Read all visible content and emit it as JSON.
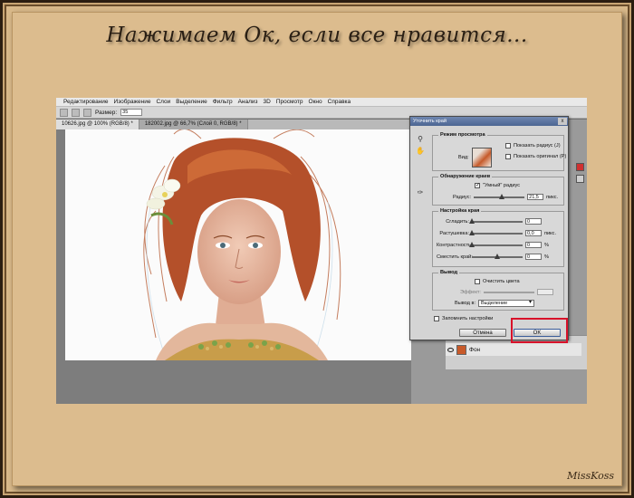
{
  "caption": "Нажимаем Ок, если все нравится...",
  "signature": "MissKoss",
  "menubar": [
    "Редактирование",
    "Изображение",
    "Слои",
    "Выделение",
    "Фильтр",
    "Анализ",
    "3D",
    "Просмотр",
    "Окно",
    "Справка"
  ],
  "options": {
    "size_label": "Размер:",
    "size_value": "35"
  },
  "doc_tabs": [
    "10626.jpg @ 100% (RGB/8) *",
    "182002.jpg @ 66,7% (Слой 0, RGB/8) *"
  ],
  "layers": {
    "layer_name": "Фон"
  },
  "colors": {
    "accent": "#d8112a",
    "title_bar": "#4c6592"
  },
  "dialog": {
    "title": "Уточнить край",
    "close": "x",
    "view_mode": {
      "title": "Режим просмотра",
      "view_label": "Вид:",
      "show_radius": "Показать радиус (J)",
      "show_original": "Показать оригинал (P)"
    },
    "edge_detection": {
      "title": "Обнаружение краев",
      "smart_radius": "\"Умный\" радиус",
      "radius_label": "Радиус:",
      "radius_value": "21,5",
      "radius_unit": "пикс.",
      "radius_fraction": 0.55
    },
    "adjust_edge": {
      "title": "Настройка края",
      "smooth_label": "Сгладить:",
      "smooth_value": "0",
      "feather_label": "Растушевка:",
      "feather_value": "0,0",
      "feather_unit": "пикс.",
      "contrast_label": "Контрастность:",
      "contrast_value": "0",
      "contrast_unit": "%",
      "shift_label": "Сместить край:",
      "shift_value": "0",
      "shift_unit": "%"
    },
    "output": {
      "title": "Вывод",
      "decontaminate": "Очистить цвета",
      "amount_label": "Эффект:",
      "output_to_label": "Вывод в:",
      "output_to_value": "Выделение"
    },
    "remember": "Запомнить настройки",
    "cancel": "Отмена",
    "ok": "OK"
  }
}
